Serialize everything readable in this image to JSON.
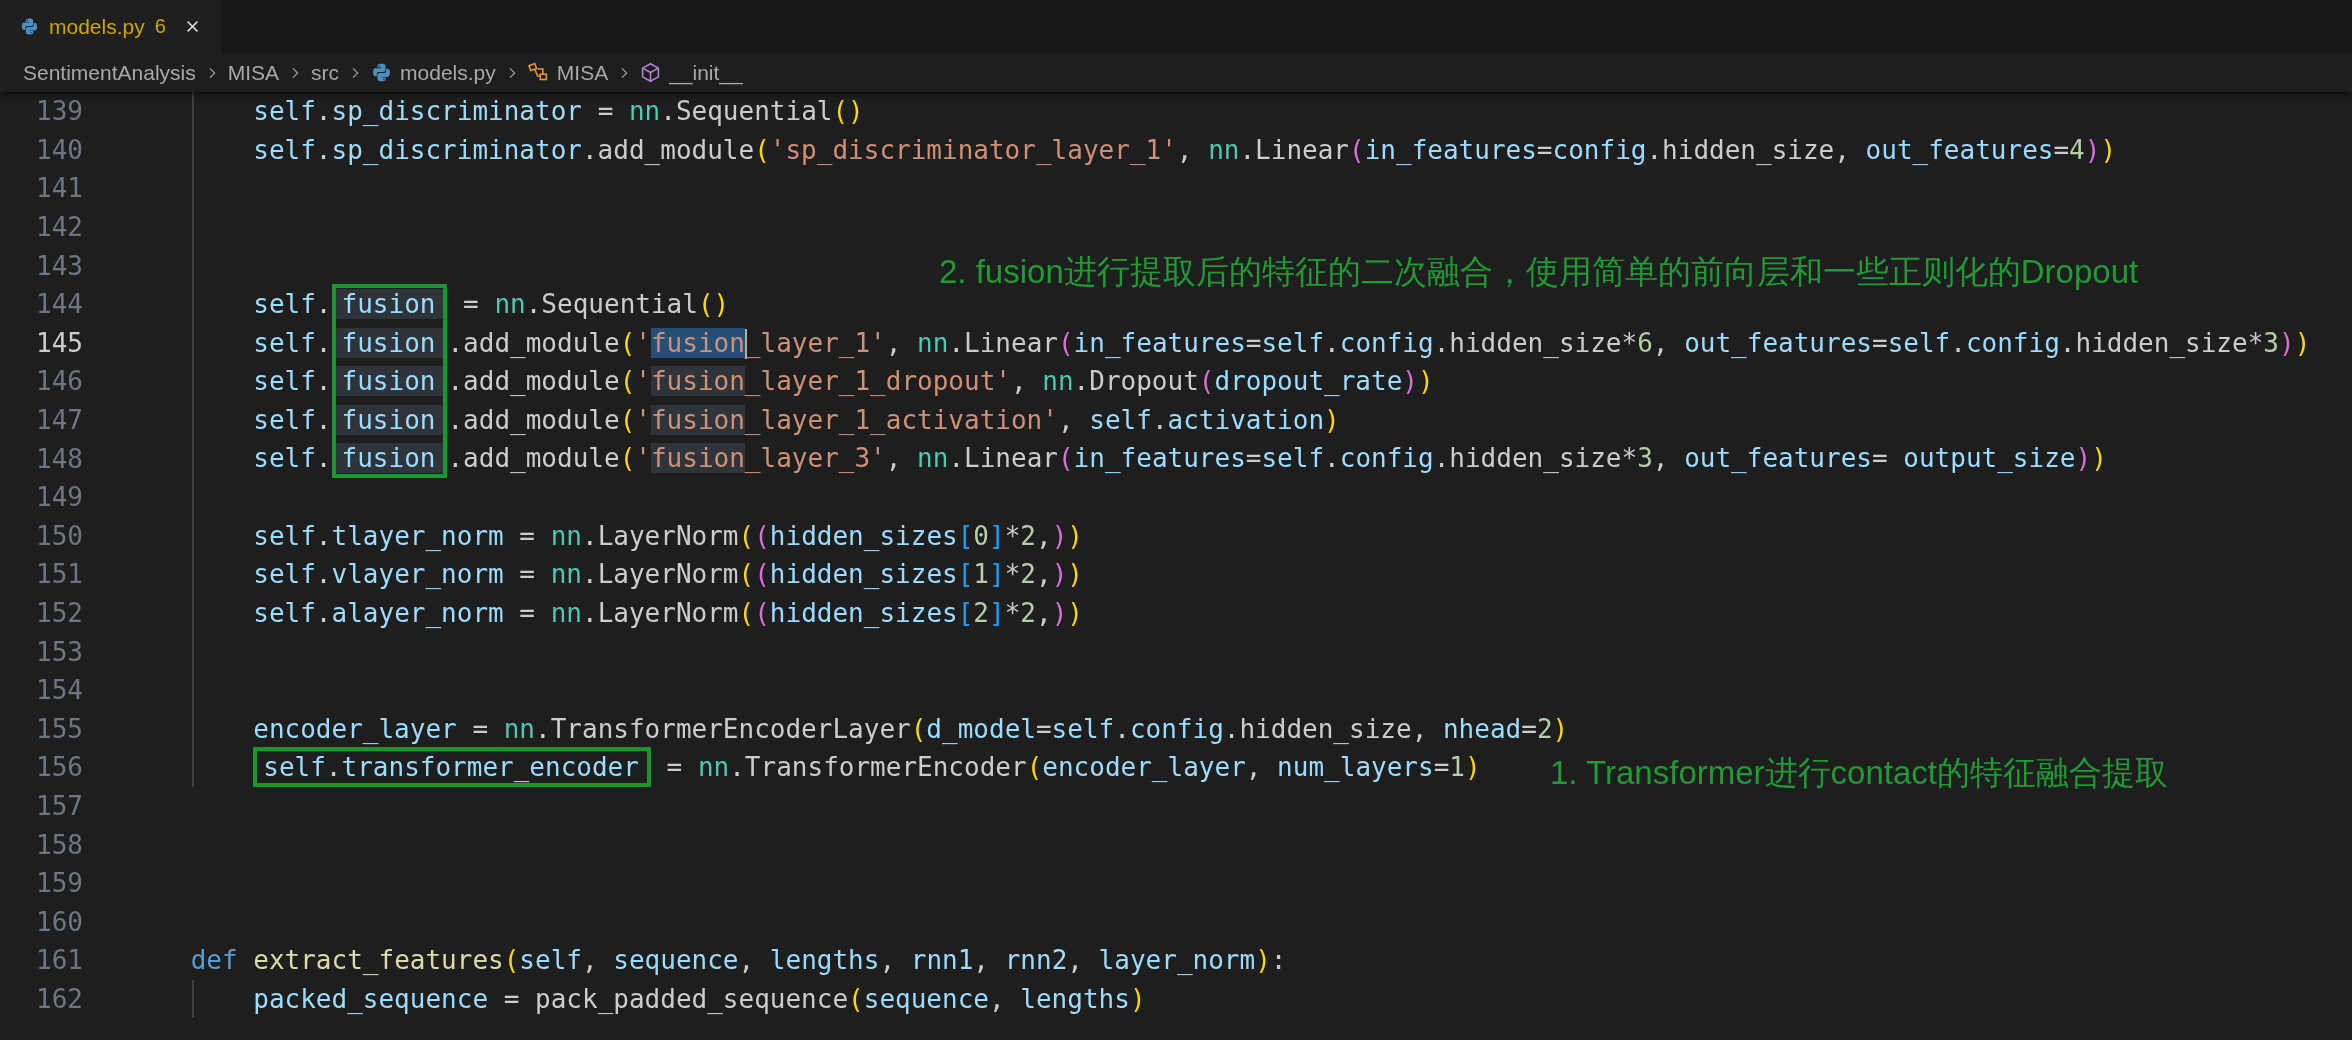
{
  "tabs": [
    {
      "label": "models.py",
      "problems": "6",
      "selected": true
    }
  ],
  "breadcrumbs": [
    {
      "text": "SentimentAnalysis"
    },
    {
      "text": "MISA"
    },
    {
      "text": "src"
    },
    {
      "text": "models.py",
      "kind": "file"
    },
    {
      "text": "MISA",
      "kind": "class"
    },
    {
      "text": "__init__",
      "kind": "method"
    }
  ],
  "editor": {
    "lines": [
      {
        "number": "139",
        "current": false,
        "tokens": [
          {
            "text": "        self",
            "kind": "variable"
          },
          {
            "text": ".",
            "kind": "plain"
          },
          {
            "text": "sp_discriminator",
            "kind": "variable"
          },
          {
            "text": " = ",
            "kind": "plain"
          },
          {
            "text": "nn",
            "kind": "module"
          },
          {
            "text": ".Sequential",
            "kind": "plain"
          },
          {
            "text": "()",
            "kind": "bracket1"
          }
        ]
      },
      {
        "number": "140",
        "current": false,
        "tokens": [
          {
            "text": "        self",
            "kind": "variable"
          },
          {
            "text": ".",
            "kind": "plain"
          },
          {
            "text": "sp_discriminator",
            "kind": "variable"
          },
          {
            "text": ".add_module",
            "kind": "plain"
          },
          {
            "text": "(",
            "kind": "bracket1"
          },
          {
            "text": "'sp_discriminator_layer_1'",
            "kind": "string"
          },
          {
            "text": ", ",
            "kind": "plain"
          },
          {
            "text": "nn",
            "kind": "module"
          },
          {
            "text": ".Linear",
            "kind": "plain"
          },
          {
            "text": "(",
            "kind": "bracket2"
          },
          {
            "text": "in_features",
            "kind": "variable"
          },
          {
            "text": "=",
            "kind": "plain"
          },
          {
            "text": "config",
            "kind": "variable"
          },
          {
            "text": ".hidden_size, ",
            "kind": "plain"
          },
          {
            "text": "out_features",
            "kind": "variable"
          },
          {
            "text": "=",
            "kind": "plain"
          },
          {
            "text": "4",
            "kind": "number"
          },
          {
            "text": ")",
            "kind": "bracket2"
          },
          {
            "text": ")",
            "kind": "bracket1"
          }
        ]
      },
      {
        "number": "141",
        "current": false
      },
      {
        "number": "142",
        "current": false
      },
      {
        "number": "143",
        "current": false,
        "note": "2. fusion进行提取后的特征的二次融合，使用简单的前向层和一些正则化的Dropout"
      },
      {
        "number": "144",
        "current": false,
        "tokens": [
          {
            "text": "        self",
            "kind": "variable"
          },
          {
            "text": ".",
            "kind": "plain"
          },
          {
            "text": "fusion",
            "kind": "variable",
            "matched": true,
            "framed": true
          },
          {
            "text": " = ",
            "kind": "plain"
          },
          {
            "text": "nn",
            "kind": "module"
          },
          {
            "text": ".Sequential",
            "kind": "plain"
          },
          {
            "text": "()",
            "kind": "bracket1"
          }
        ]
      },
      {
        "number": "145",
        "current": true,
        "tokens": [
          {
            "text": "        self",
            "kind": "variable"
          },
          {
            "text": ".",
            "kind": "plain"
          },
          {
            "text": "fusion",
            "kind": "variable",
            "matched": true,
            "framed": true
          },
          {
            "text": ".add_module",
            "kind": "plain"
          },
          {
            "text": "(",
            "kind": "bracket1"
          },
          {
            "text": "'",
            "kind": "string"
          },
          {
            "text": "fusion",
            "kind": "string",
            "selected": true
          },
          {
            "text": "_layer_1'",
            "kind": "string"
          },
          {
            "text": ", ",
            "kind": "plain"
          },
          {
            "text": "nn",
            "kind": "module"
          },
          {
            "text": ".Linear",
            "kind": "plain"
          },
          {
            "text": "(",
            "kind": "bracket2"
          },
          {
            "text": "in_features",
            "kind": "variable"
          },
          {
            "text": "=",
            "kind": "plain"
          },
          {
            "text": "self",
            "kind": "variable"
          },
          {
            "text": ".",
            "kind": "plain"
          },
          {
            "text": "config",
            "kind": "variable"
          },
          {
            "text": ".hidden_size*",
            "kind": "plain"
          },
          {
            "text": "6",
            "kind": "number"
          },
          {
            "text": ", ",
            "kind": "plain"
          },
          {
            "text": "out_features",
            "kind": "variable"
          },
          {
            "text": "=",
            "kind": "plain"
          },
          {
            "text": "self",
            "kind": "variable"
          },
          {
            "text": ".",
            "kind": "plain"
          },
          {
            "text": "config",
            "kind": "variable"
          },
          {
            "text": ".hidden_size*",
            "kind": "plain"
          },
          {
            "text": "3",
            "kind": "number"
          },
          {
            "text": ")",
            "kind": "bracket2"
          },
          {
            "text": ")",
            "kind": "bracket1"
          }
        ]
      },
      {
        "number": "146",
        "current": false,
        "tokens": [
          {
            "text": "        self",
            "kind": "variable"
          },
          {
            "text": ".",
            "kind": "plain"
          },
          {
            "text": "fusion",
            "kind": "variable",
            "matched": true,
            "framed": true
          },
          {
            "text": ".add_module",
            "kind": "plain"
          },
          {
            "text": "(",
            "kind": "bracket1"
          },
          {
            "text": "'",
            "kind": "string"
          },
          {
            "text": "fusion",
            "kind": "string",
            "matched": true
          },
          {
            "text": "_layer_1_dropout'",
            "kind": "string"
          },
          {
            "text": ", ",
            "kind": "plain"
          },
          {
            "text": "nn",
            "kind": "module"
          },
          {
            "text": ".Dropout",
            "kind": "plain"
          },
          {
            "text": "(",
            "kind": "bracket2"
          },
          {
            "text": "dropout_rate",
            "kind": "variable"
          },
          {
            "text": ")",
            "kind": "bracket2"
          },
          {
            "text": ")",
            "kind": "bracket1"
          }
        ]
      },
      {
        "number": "147",
        "current": false,
        "tokens": [
          {
            "text": "        self",
            "kind": "variable"
          },
          {
            "text": ".",
            "kind": "plain"
          },
          {
            "text": "fusion",
            "kind": "variable",
            "matched": true,
            "framed": true
          },
          {
            "text": ".add_module",
            "kind": "plain"
          },
          {
            "text": "(",
            "kind": "bracket1"
          },
          {
            "text": "'",
            "kind": "string"
          },
          {
            "text": "fusion",
            "kind": "string",
            "matched": true
          },
          {
            "text": "_layer_1_activation'",
            "kind": "string"
          },
          {
            "text": ", ",
            "kind": "plain"
          },
          {
            "text": "self",
            "kind": "variable"
          },
          {
            "text": ".",
            "kind": "plain"
          },
          {
            "text": "activation",
            "kind": "variable"
          },
          {
            "text": ")",
            "kind": "bracket1"
          }
        ]
      },
      {
        "number": "148",
        "current": false,
        "tokens": [
          {
            "text": "        self",
            "kind": "variable"
          },
          {
            "text": ".",
            "kind": "plain"
          },
          {
            "text": "fusion",
            "kind": "variable",
            "matched": true,
            "framed": true
          },
          {
            "text": ".add_module",
            "kind": "plain"
          },
          {
            "text": "(",
            "kind": "bracket1"
          },
          {
            "text": "'",
            "kind": "string"
          },
          {
            "text": "fusion",
            "kind": "string",
            "matched": true
          },
          {
            "text": "_layer_3'",
            "kind": "string"
          },
          {
            "text": ", ",
            "kind": "plain"
          },
          {
            "text": "nn",
            "kind": "module"
          },
          {
            "text": ".Linear",
            "kind": "plain"
          },
          {
            "text": "(",
            "kind": "bracket2"
          },
          {
            "text": "in_features",
            "kind": "variable"
          },
          {
            "text": "=",
            "kind": "plain"
          },
          {
            "text": "self",
            "kind": "variable"
          },
          {
            "text": ".",
            "kind": "plain"
          },
          {
            "text": "config",
            "kind": "variable"
          },
          {
            "text": ".hidden_size*",
            "kind": "plain"
          },
          {
            "text": "3",
            "kind": "number"
          },
          {
            "text": ", ",
            "kind": "plain"
          },
          {
            "text": "out_features",
            "kind": "variable"
          },
          {
            "text": "= ",
            "kind": "plain"
          },
          {
            "text": "output_size",
            "kind": "variable"
          },
          {
            "text": ")",
            "kind": "bracket2"
          },
          {
            "text": ")",
            "kind": "bracket1"
          }
        ]
      },
      {
        "number": "149",
        "current": false
      },
      {
        "number": "150",
        "current": false,
        "tokens": [
          {
            "text": "        self",
            "kind": "variable"
          },
          {
            "text": ".",
            "kind": "plain"
          },
          {
            "text": "tlayer_norm",
            "kind": "variable"
          },
          {
            "text": " = ",
            "kind": "plain"
          },
          {
            "text": "nn",
            "kind": "module"
          },
          {
            "text": ".LayerNorm",
            "kind": "plain"
          },
          {
            "text": "(",
            "kind": "bracket1"
          },
          {
            "text": "(",
            "kind": "bracket2"
          },
          {
            "text": "hidden_sizes",
            "kind": "variable"
          },
          {
            "text": "[",
            "kind": "bracket3"
          },
          {
            "text": "0",
            "kind": "number"
          },
          {
            "text": "]",
            "kind": "bracket3"
          },
          {
            "text": "*",
            "kind": "plain"
          },
          {
            "text": "2",
            "kind": "number"
          },
          {
            "text": ",",
            "kind": "plain"
          },
          {
            "text": ")",
            "kind": "bracket2"
          },
          {
            "text": ")",
            "kind": "bracket1"
          }
        ]
      },
      {
        "number": "151",
        "current": false,
        "tokens": [
          {
            "text": "        self",
            "kind": "variable"
          },
          {
            "text": ".",
            "kind": "plain"
          },
          {
            "text": "vlayer_norm",
            "kind": "variable"
          },
          {
            "text": " = ",
            "kind": "plain"
          },
          {
            "text": "nn",
            "kind": "module"
          },
          {
            "text": ".LayerNorm",
            "kind": "plain"
          },
          {
            "text": "(",
            "kind": "bracket1"
          },
          {
            "text": "(",
            "kind": "bracket2"
          },
          {
            "text": "hidden_sizes",
            "kind": "variable"
          },
          {
            "text": "[",
            "kind": "bracket3"
          },
          {
            "text": "1",
            "kind": "number"
          },
          {
            "text": "]",
            "kind": "bracket3"
          },
          {
            "text": "*",
            "kind": "plain"
          },
          {
            "text": "2",
            "kind": "number"
          },
          {
            "text": ",",
            "kind": "plain"
          },
          {
            "text": ")",
            "kind": "bracket2"
          },
          {
            "text": ")",
            "kind": "bracket1"
          }
        ]
      },
      {
        "number": "152",
        "current": false,
        "tokens": [
          {
            "text": "        self",
            "kind": "variable"
          },
          {
            "text": ".",
            "kind": "plain"
          },
          {
            "text": "alayer_norm",
            "kind": "variable"
          },
          {
            "text": " = ",
            "kind": "plain"
          },
          {
            "text": "nn",
            "kind": "module"
          },
          {
            "text": ".LayerNorm",
            "kind": "plain"
          },
          {
            "text": "(",
            "kind": "bracket1"
          },
          {
            "text": "(",
            "kind": "bracket2"
          },
          {
            "text": "hidden_sizes",
            "kind": "variable"
          },
          {
            "text": "[",
            "kind": "bracket3"
          },
          {
            "text": "2",
            "kind": "number"
          },
          {
            "text": "]",
            "kind": "bracket3"
          },
          {
            "text": "*",
            "kind": "plain"
          },
          {
            "text": "2",
            "kind": "number"
          },
          {
            "text": ",",
            "kind": "plain"
          },
          {
            "text": ")",
            "kind": "bracket2"
          },
          {
            "text": ")",
            "kind": "bracket1"
          }
        ]
      },
      {
        "number": "153",
        "current": false
      },
      {
        "number": "154",
        "current": false
      },
      {
        "number": "155",
        "current": false,
        "tokens": [
          {
            "text": "        encoder_layer",
            "kind": "variable"
          },
          {
            "text": " = ",
            "kind": "plain"
          },
          {
            "text": "nn",
            "kind": "module"
          },
          {
            "text": ".TransformerEncoderLayer",
            "kind": "plain"
          },
          {
            "text": "(",
            "kind": "bracket1"
          },
          {
            "text": "d_model",
            "kind": "variable"
          },
          {
            "text": "=",
            "kind": "plain"
          },
          {
            "text": "self",
            "kind": "variable"
          },
          {
            "text": ".",
            "kind": "plain"
          },
          {
            "text": "config",
            "kind": "variable"
          },
          {
            "text": ".hidden_size, ",
            "kind": "plain"
          },
          {
            "text": "nhead",
            "kind": "variable"
          },
          {
            "text": "=",
            "kind": "plain"
          },
          {
            "text": "2",
            "kind": "number"
          },
          {
            "text": ")",
            "kind": "bracket1"
          }
        ]
      },
      {
        "number": "156",
        "current": false,
        "note": "1. Transformer进行contact的特征融合提取",
        "tokens": [
          {
            "text": "        self",
            "kind": "variable",
            "framed": true
          },
          {
            "text": ".",
            "kind": "plain",
            "framed": true
          },
          {
            "text": "transformer_encoder",
            "kind": "variable",
            "framed": true
          },
          {
            "text": " = ",
            "kind": "plain"
          },
          {
            "text": "nn",
            "kind": "module"
          },
          {
            "text": ".TransformerEncoder",
            "kind": "plain"
          },
          {
            "text": "(",
            "kind": "bracket1"
          },
          {
            "text": "encoder_layer",
            "kind": "variable"
          },
          {
            "text": ", ",
            "kind": "plain"
          },
          {
            "text": "num_layers",
            "kind": "variable"
          },
          {
            "text": "=",
            "kind": "plain"
          },
          {
            "text": "1",
            "kind": "number"
          },
          {
            "text": ")",
            "kind": "bracket1"
          }
        ]
      },
      {
        "number": "157",
        "current": false
      },
      {
        "number": "158",
        "current": false
      },
      {
        "number": "159",
        "current": false
      },
      {
        "number": "160",
        "current": false
      },
      {
        "number": "161",
        "current": false,
        "tokens": [
          {
            "text": "    def ",
            "kind": "keyword"
          },
          {
            "text": "extract_features",
            "kind": "function"
          },
          {
            "text": "(",
            "kind": "bracket1"
          },
          {
            "text": "self",
            "kind": "variable"
          },
          {
            "text": ", ",
            "kind": "plain"
          },
          {
            "text": "sequence",
            "kind": "variable"
          },
          {
            "text": ", ",
            "kind": "plain"
          },
          {
            "text": "lengths",
            "kind": "variable"
          },
          {
            "text": ", ",
            "kind": "plain"
          },
          {
            "text": "rnn1",
            "kind": "variable"
          },
          {
            "text": ", ",
            "kind": "plain"
          },
          {
            "text": "rnn2",
            "kind": "variable"
          },
          {
            "text": ", ",
            "kind": "plain"
          },
          {
            "text": "layer_norm",
            "kind": "variable"
          },
          {
            "text": ")",
            "kind": "bracket1"
          },
          {
            "text": ":",
            "kind": "plain"
          }
        ]
      },
      {
        "number": "162",
        "current": false,
        "tokens": [
          {
            "text": "        packed_sequence",
            "kind": "variable"
          },
          {
            "text": " = ",
            "kind": "plain"
          },
          {
            "text": "pack_padded_sequence",
            "kind": "plain"
          },
          {
            "text": "(",
            "kind": "bracket1"
          },
          {
            "text": "sequence",
            "kind": "variable"
          },
          {
            "text": ", ",
            "kind": "plain"
          },
          {
            "text": "lengths",
            "kind": "variable"
          },
          {
            "text": ")",
            "kind": "bracket1"
          }
        ]
      }
    ]
  }
}
